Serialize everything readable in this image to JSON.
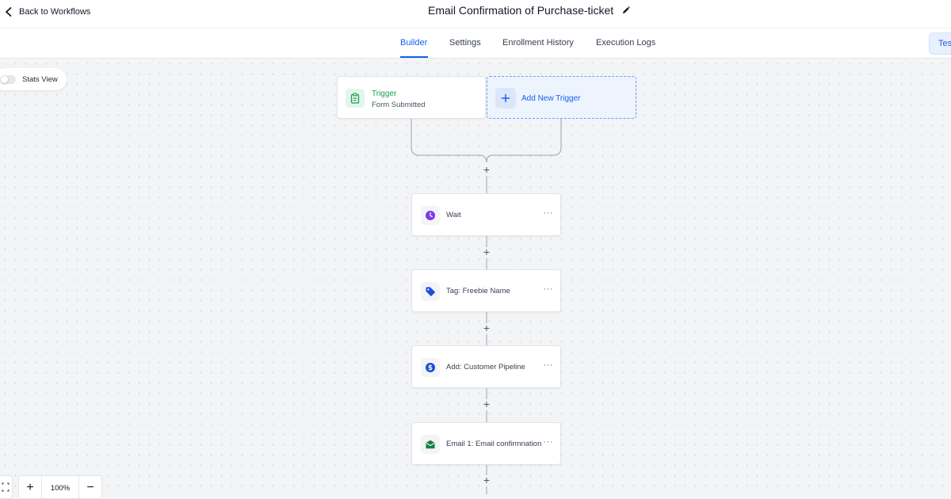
{
  "header": {
    "back_label": "Back to Workflows",
    "title": "Email Confirmation of Purchase-ticket"
  },
  "tabs": [
    {
      "label": "Builder",
      "active": true
    },
    {
      "label": "Settings",
      "active": false
    },
    {
      "label": "Enrollment History",
      "active": false
    },
    {
      "label": "Execution Logs",
      "active": false
    }
  ],
  "test_button": "Test",
  "stats_view": {
    "label": "Stats View",
    "enabled": false
  },
  "trigger": {
    "title": "Trigger",
    "subtitle": "Form Submitted",
    "icon": "clipboard-icon",
    "color": "#16a34a"
  },
  "add_trigger": {
    "label": "Add New Trigger",
    "icon": "plus-icon"
  },
  "actions": [
    {
      "label": "Wait",
      "icon": "clock-icon",
      "color": "#7c3aed"
    },
    {
      "label": "Tag: Freebie Name",
      "icon": "tag-icon",
      "color": "#1d4ed8"
    },
    {
      "label": "Add: Customer Pipeline",
      "icon": "dollar-icon",
      "color": "#1d4ed8"
    },
    {
      "label": "Email 1: Email confirmnation",
      "icon": "mail-icon",
      "color": "#15803d"
    }
  ],
  "zoom": {
    "level": "100%",
    "in_icon": "+",
    "out_icon": "−"
  },
  "colors": {
    "accent": "#155eef",
    "canvas": "#f3f4f6"
  }
}
